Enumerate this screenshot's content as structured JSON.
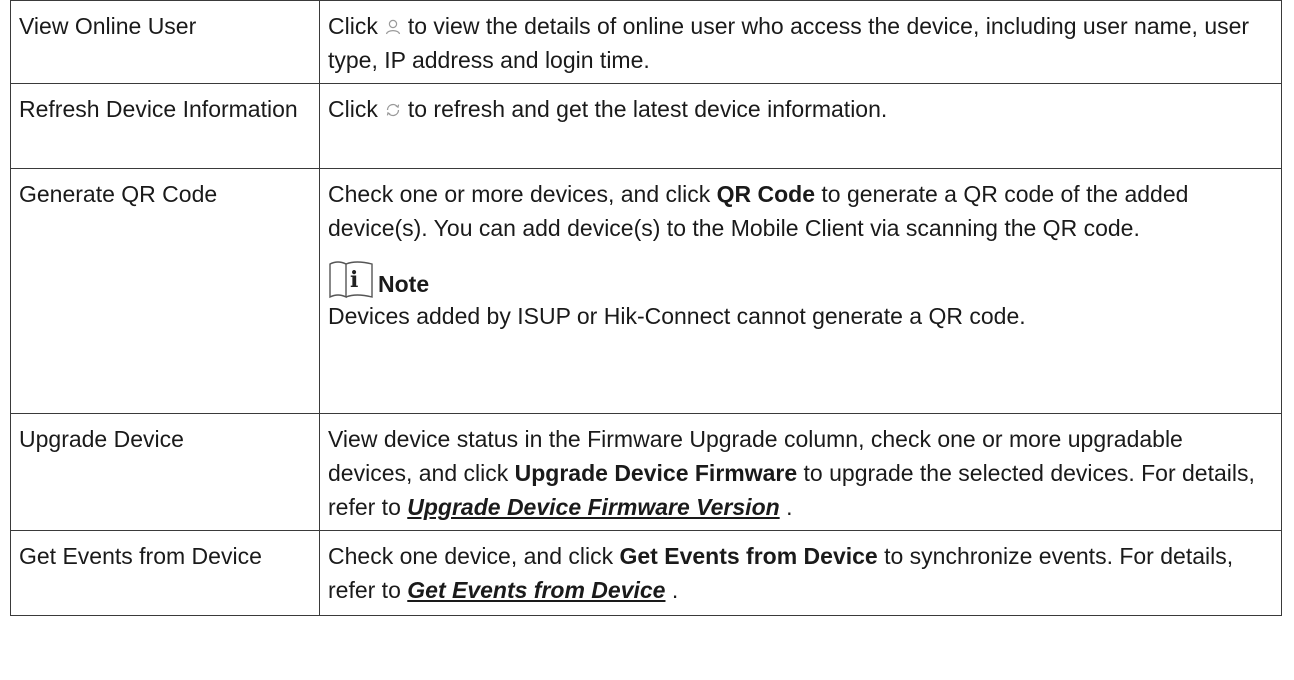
{
  "rows": [
    {
      "feature": "View Online User",
      "desc": {
        "before_icon": "Click",
        "icon": "user-icon",
        "after_icon": "to view the details of online user who access the device, including user name, user type, IP address and login time."
      }
    },
    {
      "feature": "Refresh Device Information",
      "desc": {
        "before_icon": "Click",
        "icon": "refresh-icon",
        "after_icon": "to refresh and get the latest device information."
      }
    },
    {
      "feature": "Generate QR Code",
      "desc": {
        "part1": "Check one or more devices, and click",
        "bold1": "QR Code",
        "part2": "to generate a QR code of the added device(s). You can add device(s) to the Mobile Client via scanning the QR code.",
        "note_label": "Note",
        "note_text": "Devices added by ISUP or Hik-Connect cannot generate a QR code."
      }
    },
    {
      "feature": "Upgrade Device",
      "desc": {
        "part1": "View device status in the Firmware Upgrade column, check one or more upgradable devices, and click",
        "bold1": "Upgrade Device Firmware",
        "part2": "to upgrade the selected devices. For details, refer to",
        "link": "Upgrade Device Firmware Version",
        "part3": "."
      }
    },
    {
      "feature": "Get Events from Device",
      "desc": {
        "part1": "Check one device, and click",
        "bold1": "Get Events from Device",
        "part2": "to synchronize events. For details, refer to",
        "link": "Get Events from Device",
        "part3": "."
      }
    }
  ]
}
